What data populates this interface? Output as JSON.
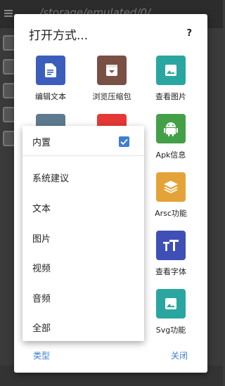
{
  "background": {
    "path_text": "/storage/emulated/0/"
  },
  "dialog": {
    "title": "打开方式...",
    "help_label": "?",
    "apps": [
      {
        "label": "编辑文本",
        "icon": "document-icon",
        "color": "#3b5dbb"
      },
      {
        "label": "浏览压缩包",
        "icon": "archive-icon",
        "color": "#7a4f44"
      },
      {
        "label": "查看图片",
        "icon": "image-icon",
        "color": "#2aa6a0"
      },
      {
        "label": "",
        "icon": "document-icon",
        "color": "#5d7a8e"
      },
      {
        "label": "",
        "icon": "code-icon",
        "color": "#e53935"
      },
      {
        "label": "Apk信息",
        "icon": "android-icon",
        "color": "#43a047"
      },
      {
        "label": "Arsc功能",
        "icon": "layers-icon",
        "color": "#e4a338"
      },
      {
        "label": "查看字体",
        "icon": "font-icon",
        "color": "#3f4fb5"
      },
      {
        "label": "Svg功能",
        "icon": "image-icon",
        "color": "#2aa6a0"
      }
    ],
    "footer_left": "类型",
    "footer_right": "关闭"
  },
  "popup": {
    "items": [
      {
        "label": "内置",
        "checked": true
      },
      {
        "label": "系统建议"
      },
      {
        "label": "文本"
      },
      {
        "label": "图片"
      },
      {
        "label": "视频"
      },
      {
        "label": "音频"
      },
      {
        "label": "全部"
      }
    ],
    "accent_color": "#3d7fd1"
  }
}
